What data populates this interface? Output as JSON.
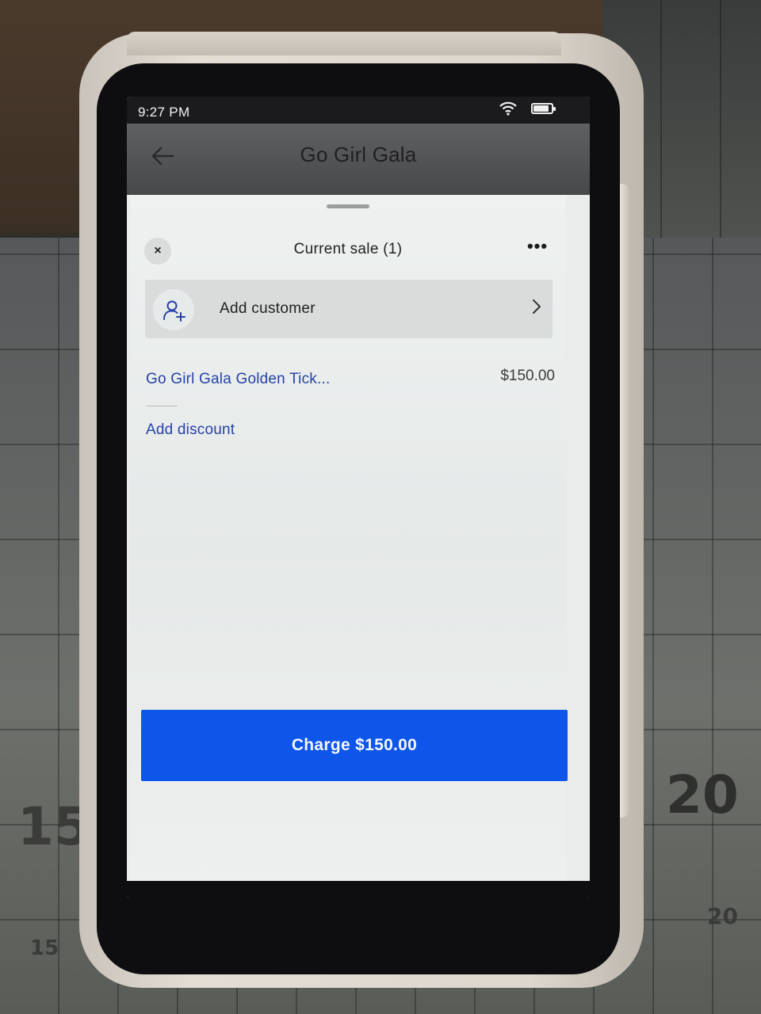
{
  "status_bar": {
    "time": "9:27 PM"
  },
  "app_bar": {
    "title": "Go Girl Gala"
  },
  "sheet": {
    "title": "Current sale (1)",
    "more_label": "•••",
    "close_label": "×",
    "customer": {
      "label": "Add customer"
    },
    "items": [
      {
        "name": "Go Girl Gala Golden Tick...",
        "price": "$150.00"
      }
    ],
    "discount_label": "Add discount",
    "charge_label": "Charge $150.00"
  },
  "background": {
    "ruler_numbers": [
      "20",
      "15",
      "20",
      "15"
    ]
  },
  "colors": {
    "accent": "#0e55ea",
    "link": "#2742a8"
  }
}
